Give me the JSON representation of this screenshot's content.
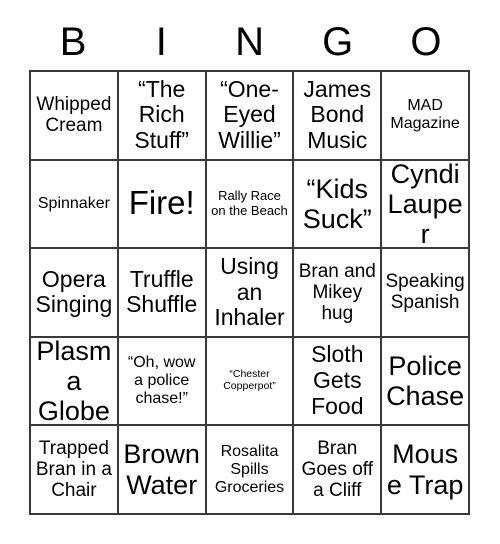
{
  "card": {
    "header_letters": [
      "B",
      "I",
      "N",
      "G",
      "O"
    ],
    "columns": 5,
    "rows": 5,
    "border_color": "#3a3a3a",
    "background_color": "#ffffff",
    "text_color": "#000000",
    "cells": [
      {
        "text": "Whipped Cream",
        "size": "md"
      },
      {
        "text": "“The Rich Stuff”",
        "size": "lg"
      },
      {
        "text": "“One-Eyed Willie”",
        "size": "lg"
      },
      {
        "text": "James Bond Music",
        "size": "lg"
      },
      {
        "text": "MAD Magazine",
        "size": "sm"
      },
      {
        "text": "Spinnaker",
        "size": "sm"
      },
      {
        "text": "Fire!",
        "size": "xxl"
      },
      {
        "text": "Rally Race on the Beach",
        "size": "xs"
      },
      {
        "text": "“Kids Suck”",
        "size": "xl"
      },
      {
        "text": "Cyndi Lauper",
        "size": "xl"
      },
      {
        "text": "Opera Singing",
        "size": "lg"
      },
      {
        "text": "Truffle Shuffle",
        "size": "lg"
      },
      {
        "text": "Using an Inhaler",
        "size": "lg"
      },
      {
        "text": "Bran and Mikey hug",
        "size": "md"
      },
      {
        "text": "Speaking Spanish",
        "size": "md"
      },
      {
        "text": "Plasma Globe",
        "size": "xl"
      },
      {
        "text": "“Oh, wow a police chase!”",
        "size": "sm"
      },
      {
        "text": "“Chester Copperpot”",
        "size": "xxs"
      },
      {
        "text": "Sloth Gets Food",
        "size": "lg"
      },
      {
        "text": "Police Chase",
        "size": "xl"
      },
      {
        "text": "Trapped Bran in a Chair",
        "size": "md"
      },
      {
        "text": "Brown Water",
        "size": "xl"
      },
      {
        "text": "Rosalita Spills Groceries",
        "size": "sm"
      },
      {
        "text": "Bran Goes off a Cliff",
        "size": "md"
      },
      {
        "text": "Mouse Trap",
        "size": "xl"
      }
    ]
  }
}
